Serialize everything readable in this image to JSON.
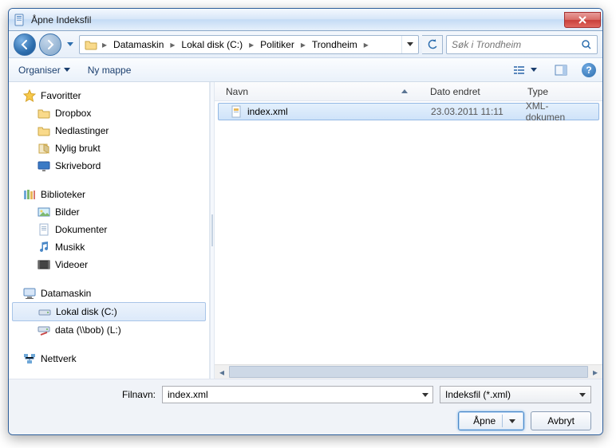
{
  "window": {
    "title": "Åpne Indeksfil"
  },
  "nav": {
    "crumbs": [
      "Datamaskin",
      "Lokal disk (C:)",
      "Politiker",
      "Trondheim"
    ],
    "search_placeholder": "Søk i Trondheim"
  },
  "toolbar": {
    "organize": "Organiser",
    "new_folder": "Ny mappe"
  },
  "tree": {
    "favorites": {
      "label": "Favoritter",
      "items": [
        "Dropbox",
        "Nedlastinger",
        "Nylig brukt",
        "Skrivebord"
      ]
    },
    "libraries": {
      "label": "Biblioteker",
      "items": [
        "Bilder",
        "Dokumenter",
        "Musikk",
        "Videoer"
      ]
    },
    "computer": {
      "label": "Datamaskin",
      "items": [
        "Lokal disk (C:)",
        "data (\\\\bob) (L:)"
      ]
    },
    "network": {
      "label": "Nettverk"
    }
  },
  "columns": {
    "name": "Navn",
    "modified": "Dato endret",
    "type": "Type"
  },
  "files": [
    {
      "name": "index.xml",
      "modified": "23.03.2011 11:11",
      "type": "XML-dokumen"
    }
  ],
  "footer": {
    "filename_label": "Filnavn:",
    "filename_value": "index.xml",
    "filter": "Indeksfil (*.xml)",
    "open": "Åpne",
    "cancel": "Avbryt"
  }
}
